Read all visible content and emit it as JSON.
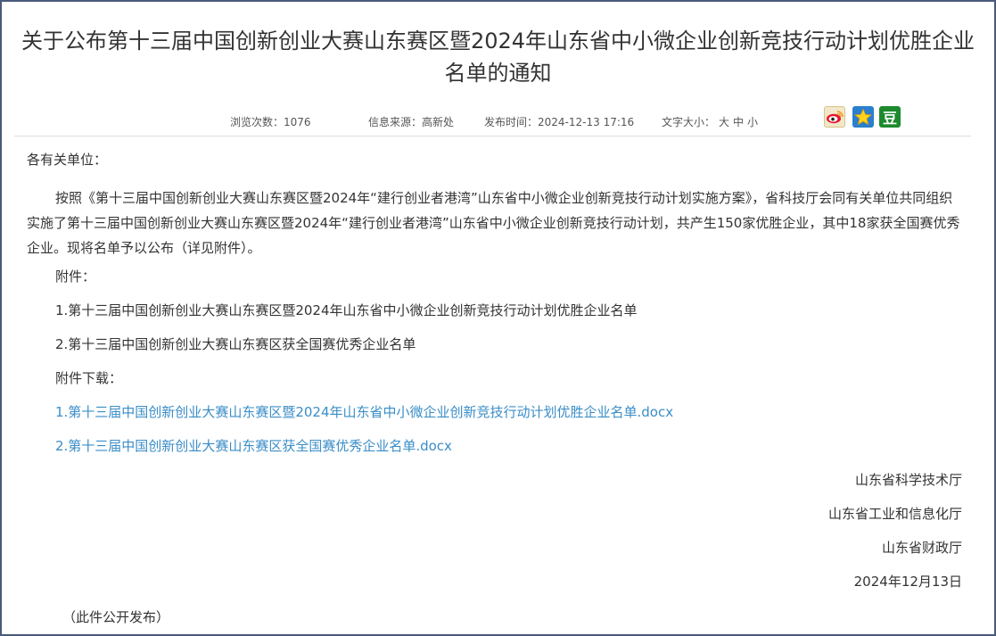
{
  "article": {
    "title": "关于公布第十三届中国创新创业大赛山东赛区暨2024年山东省中小微企业创新竞技行动计划优胜企业名单的通知",
    "meta": {
      "views_label": "浏览次数：",
      "views": "1076",
      "source_label": "信息来源：",
      "source": "高新处",
      "date_label": "发布时间：",
      "date": "2024-12-13 17:16",
      "font_size_label": "文字大小：",
      "size_large": "大",
      "size_medium": "中",
      "size_small": "小"
    },
    "share": {
      "icons": [
        "weibo-icon",
        "qzone-icon",
        "douban-icon"
      ],
      "douban_glyph": "豆"
    },
    "salutation": "各有关单位：",
    "body": "按照《第十三届中国创新创业大赛山东赛区暨2024年“建行创业者港湾”山东省中小微企业创新竞技行动计划实施方案》，省科技厅会同有关单位共同组织实施了第十三届中国创新创业大赛山东赛区暨2024年“建行创业者港湾”山东省中小微企业创新竞技行动计划，共产生150家优胜企业，其中18家获全国赛优秀企业。现将名单予以公布（详见附件）。",
    "attachments_label": "附件：",
    "attachments": [
      "1.第十三届中国创新创业大赛山东赛区暨2024年山东省中小微企业创新竞技行动计划优胜企业名单",
      "2.第十三届中国创新创业大赛山东赛区获全国赛优秀企业名单"
    ],
    "downloads_label": "附件下载：",
    "downloads": [
      "1.第十三届中国创新创业大赛山东赛区暨2024年山东省中小微企业创新竞技行动计划优胜企业名单.docx",
      "2.第十三届中国创新创业大赛山东赛区获全国赛优秀企业名单.docx"
    ],
    "signatories": [
      "山东省科学技术厅",
      "山东省工业和信息化厅",
      "山东省财政厅"
    ],
    "sign_date": "2024年12月13日",
    "publish_note": "（此件公开发布）"
  },
  "colors": {
    "link": "#3a8dc7",
    "frame_border": "#4a5a7a",
    "text": "#333333"
  }
}
